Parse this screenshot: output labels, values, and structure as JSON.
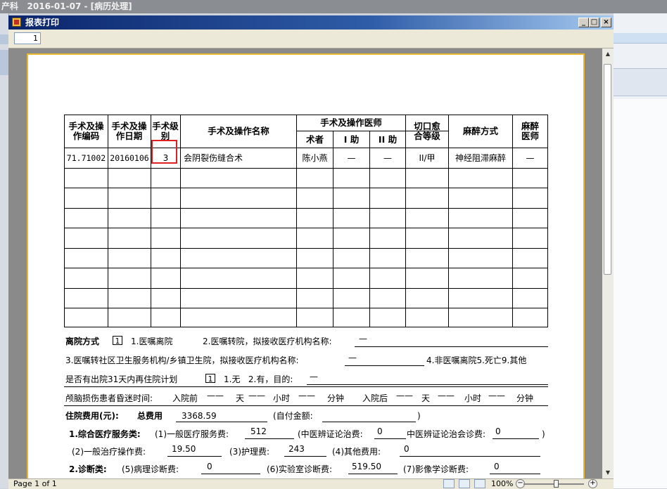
{
  "background_app": {
    "title": "产科   2016-01-07 - [病历处理]"
  },
  "window": {
    "title": "报表打印",
    "controls": {
      "minimize": "_",
      "maximize": "□",
      "close": "×"
    }
  },
  "toolbar": {
    "page_value": "1"
  },
  "status": {
    "page_text": "Page 1 of 1",
    "zoom": "100%"
  },
  "table": {
    "headers": {
      "op_code": "手术及操作编码",
      "op_date": "手术及操作日期",
      "op_level": "手术级别",
      "op_name": "手术及操作名称",
      "op_doctors": "手术及操作医师",
      "surgeon": "术者",
      "assist1": "I 助",
      "assist2": "II 助",
      "incision": "切口愈合等级",
      "anesthesia": "麻醉方式",
      "anesthetist": "麻醉医师"
    },
    "rows": [
      {
        "code": "71.71002",
        "date": "20160106",
        "level": "3",
        "name": "会阴裂伤缝合术",
        "surgeon": "陈小燕",
        "assist1": "—",
        "assist2": "—",
        "incision": "II/甲",
        "anesthesia": "神经阻滞麻醉",
        "anesthetist": "—"
      }
    ]
  },
  "discharge": {
    "label": "离院方式",
    "value": "1",
    "opt1": "1.医嘱离院",
    "opt2": "2.医嘱转院，拟接收医疗机构名称:",
    "opt2_value": "—",
    "opt3": "3.医嘱转社区卫生服务机构/乡镇卫生院，拟接收医疗机构名称:",
    "opt3_value": "—",
    "opt4": "4.非医嘱离院5.死亡9.其他"
  },
  "readmit": {
    "label": "是否有出院31天内再住院计划",
    "value": "1",
    "opts": "1.无   2.有，目的:",
    "purpose": "—"
  },
  "coma": {
    "label": "颅脑损伤患者昏迷时间:",
    "before": "入院前",
    "after": "入院后",
    "day": "天",
    "hour": "小时",
    "minute": "分钟",
    "blank": "——"
  },
  "cost": {
    "label": "住院费用(元):",
    "total_label": "总费用",
    "total": "3368.59",
    "self_pay": "(自付金额:",
    "self_pay_end": ")",
    "cat1": "1.综合医疗服务类:",
    "item1": "(1)一般医疗服务费:",
    "item1_val": "512",
    "tcm1": "(中医辨证论治费:",
    "tcm1_val": "0",
    "tcm2": "中医辨证论治会诊费:",
    "tcm2_val": "0",
    "close_paren": ")",
    "item2": "(2)一般治疗操作费:",
    "item2_val": "19.50",
    "item3": "(3)护理费:",
    "item3_val": "243",
    "item4": "(4)其他费用:",
    "item4_val": "0",
    "cat2": "2.诊断类:",
    "item5": "(5)病理诊断费:",
    "item5_val": "0",
    "item6": "(6)实验室诊断费:",
    "item6_val": "519.50",
    "item7": "(7)影像学诊断费:",
    "item7_val": "0"
  }
}
